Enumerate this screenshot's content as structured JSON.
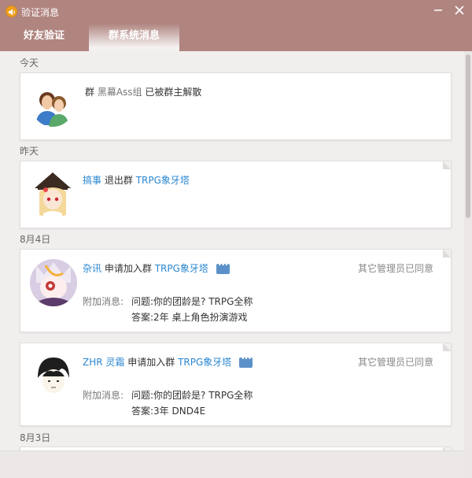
{
  "window": {
    "title": "验证消息"
  },
  "tabs": [
    {
      "label": "好友验证"
    },
    {
      "label": "群系统消息"
    }
  ],
  "sections": [
    {
      "date": "今天",
      "items": [
        {
          "group_prefix": "群",
          "group_name": "黑幕Ass组",
          "action": "已被群主解散"
        }
      ]
    },
    {
      "date": "昨天",
      "items": [
        {
          "user": "搞事",
          "action": "退出群",
          "group_name": "TRPG象牙塔"
        }
      ]
    },
    {
      "date": "8月4日",
      "items": [
        {
          "user": "杂讯",
          "action": "申请加入群",
          "group_name": "TRPG象牙塔",
          "status": "其它管理员已同意",
          "extra_label": "附加消息:",
          "question": "问题:你的团龄是? TRPG全称",
          "answer": "答案:2年 桌上角色扮演游戏"
        },
        {
          "user": "ZHR 灵霜",
          "action": "申请加入群",
          "group_name": "TRPG象牙塔",
          "status": "其它管理员已同意",
          "extra_label": "附加消息:",
          "question": "问题:你的团龄是? TRPG全称",
          "answer": "答案:3年 DND4E"
        }
      ]
    },
    {
      "date": "8月3日",
      "items": []
    }
  ],
  "colors": {
    "accent": "#b08580",
    "link": "#2b87d1",
    "background": "#f1efee"
  },
  "icons": [
    "speaker-icon",
    "minimize-icon",
    "close-icon",
    "chat-bubble-icon"
  ]
}
